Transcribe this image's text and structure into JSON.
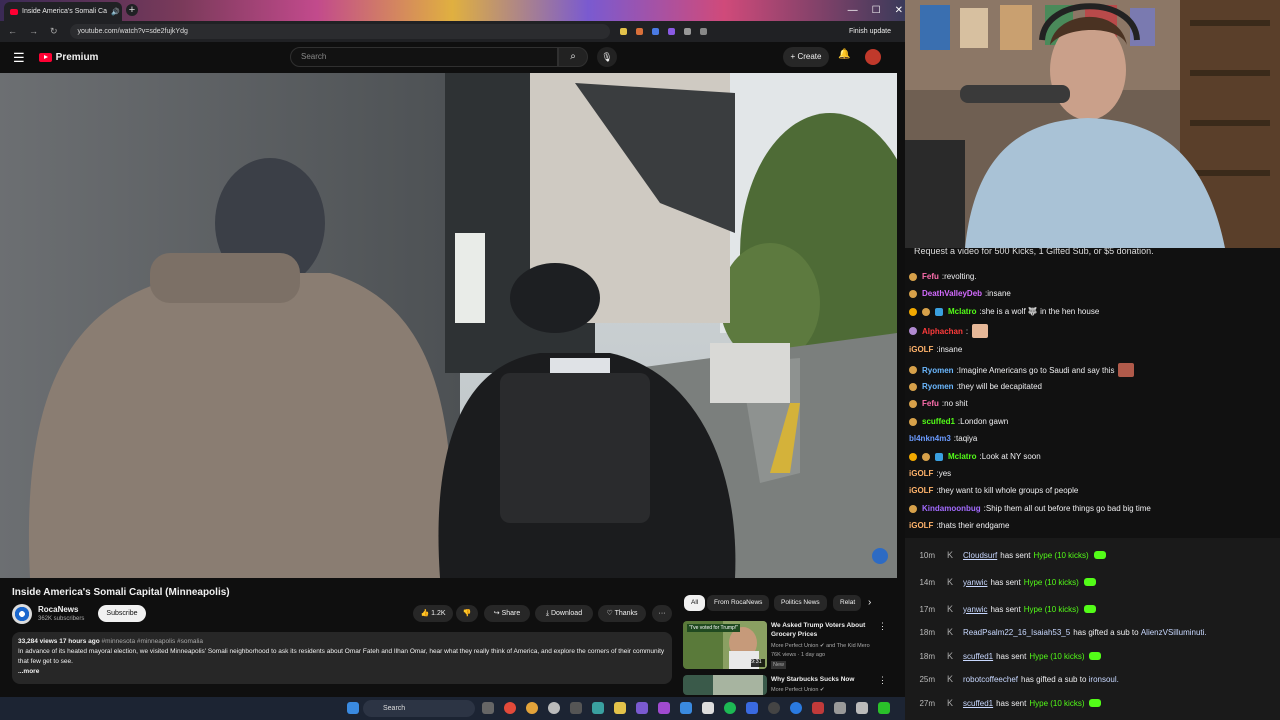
{
  "browser": {
    "tab_title": "Inside America's Somali Ca",
    "new_tab": "+",
    "url": "youtube.com/watch?v=sde2fujkYdg",
    "finish_update": "Finish update"
  },
  "yt": {
    "premium": "Premium",
    "search_placeholder": "Search",
    "create": "+ Create"
  },
  "video": {
    "title": "Inside America's Somali Capital (Minneapolis)",
    "channel": "RocaNews",
    "subscribers": "362K subscribers",
    "subscribe": "Subscribe",
    "likes": "1.2K",
    "share": "Share",
    "download": "Download",
    "thanks": "Thanks",
    "views": "33,284 views",
    "age": "17 hours ago",
    "tags": "#minnesota #minneapolis #somalia",
    "description": "In advance of its heated mayoral election, we visited Minneapolis' Somali neighborhood to ask its residents about Omar Fateh and Ilhan Omar, hear what they really think of America, and explore the corners of their community that few get to see.",
    "more": "...more"
  },
  "chips": [
    "All",
    "From RocaNews",
    "Politics News",
    "Relat"
  ],
  "related": [
    {
      "title": "We Asked Trump Voters About Grocery Prices",
      "channel": "More Perfect Union",
      "channel2": "and The Kid Mero",
      "meta": "76K views · 1 day ago",
      "badge": "New",
      "duration": "9:31",
      "thumb_text": "\"I've voted for Trump!\""
    },
    {
      "title": "Why Starbucks Sucks Now",
      "channel": "More Perfect Union"
    }
  ],
  "chat": {
    "banner": "Request a video for 500 Kicks, 1 Gifted Sub, or $5 donation.",
    "messages": [
      {
        "user": "Fefu",
        "text": "revolting.",
        "color": "#ff6fae"
      },
      {
        "user": "DeathValleyDeb",
        "text": "insane",
        "color": "#d36bff"
      },
      {
        "user": "Mclatro",
        "text": "she is a wolf 🐺 in the hen house",
        "color": "#53fc18"
      },
      {
        "user": "Alphachan",
        "text": "",
        "color": "#ff3b3b"
      },
      {
        "user": "iGOLF",
        "text": "insane",
        "color": "#ffb36b"
      },
      {
        "user": "Ryomen",
        "text": "Imagine Americans go to Saudi and say this",
        "color": "#6bb8ff"
      },
      {
        "user": "Ryomen",
        "text": "they will be decapitated",
        "color": "#6bb8ff"
      },
      {
        "user": "Fefu",
        "text": "no shit",
        "color": "#ff6fae"
      },
      {
        "user": "scuffed1",
        "text": "London gawn",
        "color": "#53fc18"
      },
      {
        "user": "bl4nkn4m3",
        "text": "taqiya",
        "color": "#6b9bff"
      },
      {
        "user": "Mclatro",
        "text": "Look at NY soon",
        "color": "#53fc18"
      },
      {
        "user": "iGOLF",
        "text": "yes",
        "color": "#ffb36b"
      },
      {
        "user": "iGOLF",
        "text": "they want to kill whole groups of people",
        "color": "#ffb36b"
      },
      {
        "user": "Kindamoonbug",
        "text": "Ship them all out before things go bad big time",
        "color": "#a36bff"
      },
      {
        "user": "iGOLF",
        "text": "thats their endgame",
        "color": "#ffb36b"
      }
    ]
  },
  "events": [
    {
      "time": "10m",
      "user": "Cloudsurf",
      "action": "has sent",
      "gift": "Hype (10 kicks)"
    },
    {
      "time": "14m",
      "user": "yanwic",
      "action": "has sent",
      "gift": "Hype (10 kicks)"
    },
    {
      "time": "17m",
      "user": "yanwic",
      "action": "has sent",
      "gift": "Hype (10 kicks)"
    },
    {
      "time": "18m",
      "user": "ReadPsalm22_16_Isaiah53_5",
      "action": "has gifted a sub to",
      "target": "AlienzVSilluminuti."
    },
    {
      "time": "18m",
      "user": "scuffed1",
      "action": "has sent",
      "gift": "Hype (10 kicks)"
    },
    {
      "time": "25m",
      "user": "robotcoffeechef",
      "action": "has gifted a sub to",
      "target": "ironsoul."
    },
    {
      "time": "27m",
      "user": "scuffed1",
      "action": "has sent",
      "gift": "Hype (10 kicks)"
    }
  ],
  "taskbar": {
    "search": "Search"
  }
}
